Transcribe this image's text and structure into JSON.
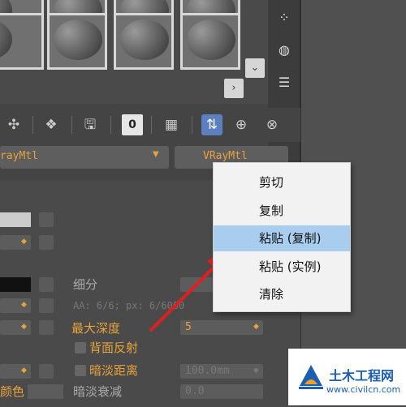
{
  "toolbar": {
    "zero_label": "0"
  },
  "material": {
    "name_dropdown": "rayMtl",
    "type_button": "VRayMtl"
  },
  "params": {
    "fine_label": "细分",
    "aa_text": "AA: 6/6; px: 6/6000",
    "max_depth_label": "最大深度",
    "max_depth_value": "5",
    "back_reflect_label": "背面反射",
    "dim_distance_label": "暗淡距离",
    "dim_distance_value": "100.0mm",
    "dim_falloff_label": "暗淡衰减",
    "dim_falloff_value": "0.0",
    "color_label": "颜色"
  },
  "context_menu": {
    "items": [
      {
        "label": "剪切"
      },
      {
        "label": "复制"
      },
      {
        "label": "粘贴 (复制)"
      },
      {
        "label": "粘贴 (实例)"
      },
      {
        "label": "清除"
      }
    ],
    "highlighted_index": 2
  },
  "watermark": {
    "text": "土木工程网",
    "url": "www.civilcn.com",
    "logo_colors": [
      "#1a5fb4",
      "#f0a020"
    ]
  },
  "colors": {
    "accent_orange": "#e8a23a",
    "menu_highlight": "#a9cdef",
    "arrow_red": "#e02020"
  }
}
